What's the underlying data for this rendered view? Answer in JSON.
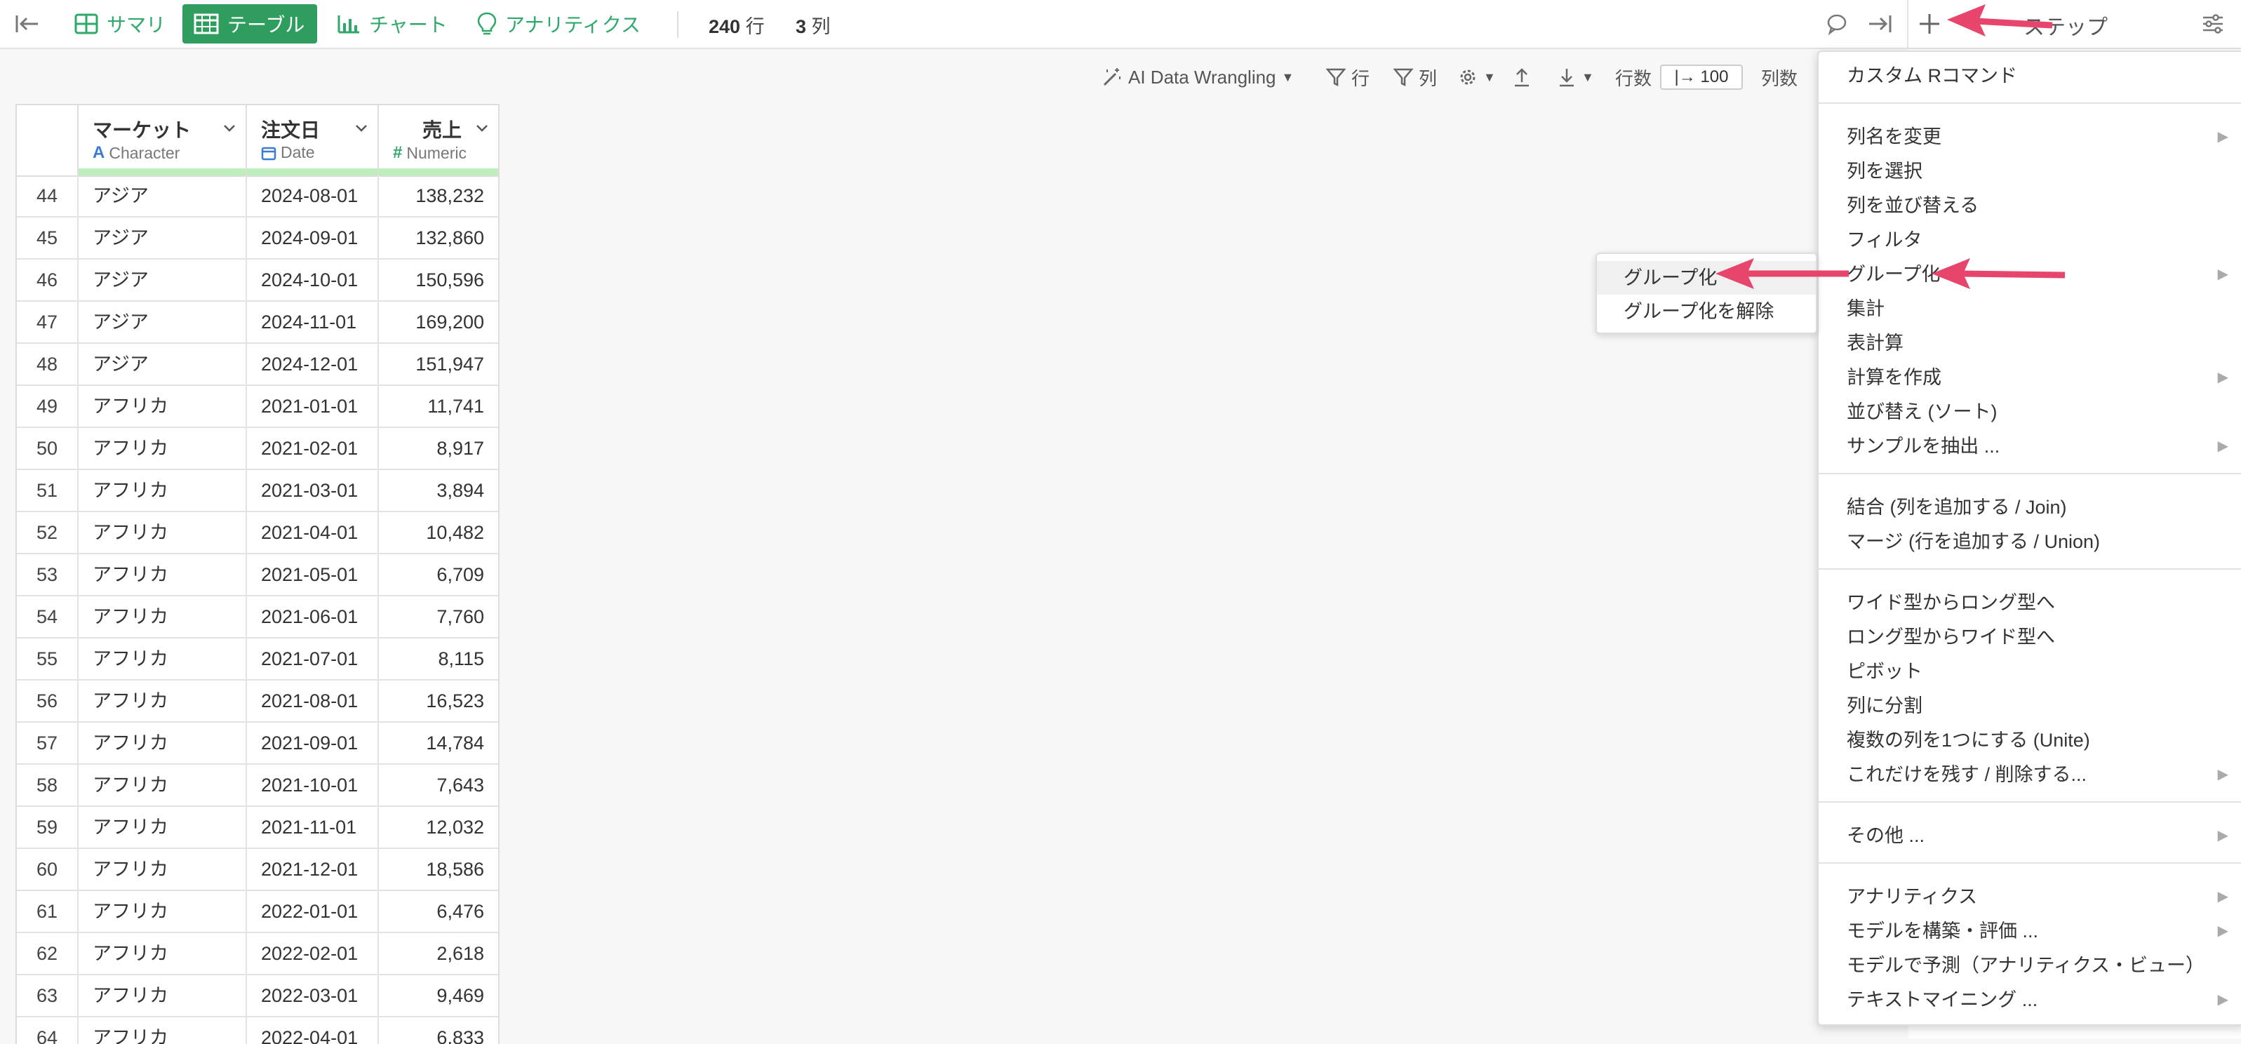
{
  "topbar": {
    "tabs": [
      {
        "label": "サマリ",
        "icon": "summary-icon",
        "active": false
      },
      {
        "label": "テーブル",
        "icon": "table-icon",
        "active": true
      },
      {
        "label": "チャート",
        "icon": "chart-icon",
        "active": false
      },
      {
        "label": "アナリティクス",
        "icon": "lightbulb-icon",
        "active": false
      }
    ],
    "row_count": "240",
    "row_unit": "行",
    "col_count": "3",
    "col_unit": "列",
    "steps_title": "ステップ"
  },
  "toolbar": {
    "ai_label": "AI Data Wrangling",
    "filter_rows": "行",
    "filter_cols": "列",
    "rows_label": "行数",
    "rows_value": "|→ 100",
    "cols_label": "列数"
  },
  "table": {
    "columns": [
      {
        "name": "マーケット",
        "type": "Character",
        "type_icon": "A"
      },
      {
        "name": "注文日",
        "type": "Date",
        "type_icon": "calendar-icon"
      },
      {
        "name": "売上",
        "type": "Numeric",
        "type_icon": "#"
      }
    ],
    "rows": [
      [
        "44",
        "アジア",
        "2024-08-01",
        "138,232"
      ],
      [
        "45",
        "アジア",
        "2024-09-01",
        "132,860"
      ],
      [
        "46",
        "アジア",
        "2024-10-01",
        "150,596"
      ],
      [
        "47",
        "アジア",
        "2024-11-01",
        "169,200"
      ],
      [
        "48",
        "アジア",
        "2024-12-01",
        "151,947"
      ],
      [
        "49",
        "アフリカ",
        "2021-01-01",
        "11,741"
      ],
      [
        "50",
        "アフリカ",
        "2021-02-01",
        "8,917"
      ],
      [
        "51",
        "アフリカ",
        "2021-03-01",
        "3,894"
      ],
      [
        "52",
        "アフリカ",
        "2021-04-01",
        "10,482"
      ],
      [
        "53",
        "アフリカ",
        "2021-05-01",
        "6,709"
      ],
      [
        "54",
        "アフリカ",
        "2021-06-01",
        "7,760"
      ],
      [
        "55",
        "アフリカ",
        "2021-07-01",
        "8,115"
      ],
      [
        "56",
        "アフリカ",
        "2021-08-01",
        "16,523"
      ],
      [
        "57",
        "アフリカ",
        "2021-09-01",
        "14,784"
      ],
      [
        "58",
        "アフリカ",
        "2021-10-01",
        "7,643"
      ],
      [
        "59",
        "アフリカ",
        "2021-11-01",
        "12,032"
      ],
      [
        "60",
        "アフリカ",
        "2021-12-01",
        "18,586"
      ],
      [
        "61",
        "アフリカ",
        "2022-01-01",
        "6,476"
      ],
      [
        "62",
        "アフリカ",
        "2022-02-01",
        "2,618"
      ],
      [
        "63",
        "アフリカ",
        "2022-03-01",
        "9,469"
      ],
      [
        "64",
        "アフリカ",
        "2022-04-01",
        "6,833"
      ]
    ]
  },
  "menu": {
    "groups": [
      [
        {
          "label": "カスタム Rコマンド",
          "sub": false
        }
      ],
      [
        {
          "label": "列名を変更",
          "sub": true
        },
        {
          "label": "列を選択",
          "sub": false
        },
        {
          "label": "列を並び替える",
          "sub": false
        },
        {
          "label": "フィルタ",
          "sub": false
        },
        {
          "label": "グループ化",
          "sub": true
        },
        {
          "label": "集計",
          "sub": false
        },
        {
          "label": "表計算",
          "sub": false
        },
        {
          "label": "計算を作成",
          "sub": true
        },
        {
          "label": "並び替え (ソート)",
          "sub": false
        },
        {
          "label": "サンプルを抽出 ...",
          "sub": true
        }
      ],
      [
        {
          "label": "結合 (列を追加する / Join)",
          "sub": false
        },
        {
          "label": "マージ (行を追加する / Union)",
          "sub": false
        }
      ],
      [
        {
          "label": "ワイド型からロング型へ",
          "sub": false
        },
        {
          "label": "ロング型からワイド型へ",
          "sub": false
        },
        {
          "label": "ピボット",
          "sub": false
        },
        {
          "label": "列に分割",
          "sub": false
        },
        {
          "label": "複数の列を1つにする (Unite)",
          "sub": false
        },
        {
          "label": "これだけを残す / 削除する...",
          "sub": true
        }
      ],
      [
        {
          "label": "その他 ...",
          "sub": true
        }
      ],
      [
        {
          "label": "アナリティクス",
          "sub": true
        },
        {
          "label": "モデルを構築・評価 ...",
          "sub": true
        },
        {
          "label": "モデルで予測（アナリティクス・ビュー）",
          "sub": false
        },
        {
          "label": "テキストマイニング ...",
          "sub": true
        }
      ]
    ]
  },
  "submenu": {
    "items": [
      {
        "label": "グループ化"
      },
      {
        "label": "グループ化を解除"
      }
    ]
  },
  "colors": {
    "accent": "#2e9d5e",
    "accent_text": "#2ea96a",
    "arrow": "#e8456c",
    "header_bar": "#bfeebd"
  }
}
